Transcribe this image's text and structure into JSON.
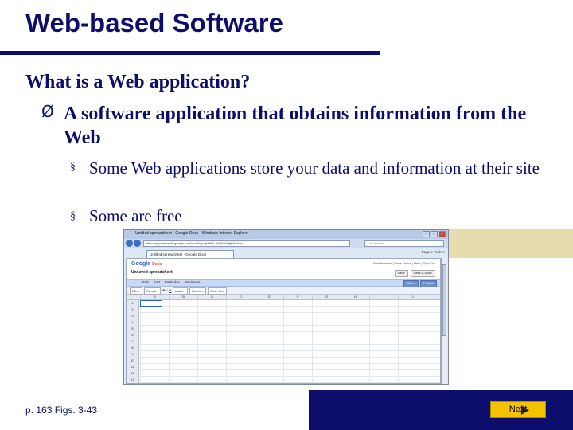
{
  "slide": {
    "title": "Web-based Software",
    "heading": "What is a Web application?",
    "bullet_level1": {
      "marker": "Ø",
      "text": "A software application that obtains information from the Web"
    },
    "bullets_level2": [
      {
        "marker": "§",
        "text": "Some Web applications store your data and information at their site"
      },
      {
        "marker": "§",
        "text": "Some are free"
      }
    ],
    "caption": "p. 163 Figs. 3-43",
    "next_label": "Next"
  },
  "browser": {
    "window_title": "Untitled spreadsheet - Google Docs - Windows Internet Explorer",
    "window_controls": [
      "–",
      "□",
      "×"
    ],
    "address": "http://spreadsheets.google.com/ccc?key=pYMeL-hQFmN8gWsIAdw",
    "search_placeholder": "Live Search",
    "tab_label": "Untitled spreadsheet - Google Docs",
    "tab_tools": "Page ▾  Tools ▾",
    "page": {
      "logo": "Google",
      "logo_sub": "Docs",
      "doc_name": "Unsaved spreadsheet",
      "top_links": "| New features | Docs Home | Help | Sign Out",
      "top_buttons": [
        "Save",
        "Save & close"
      ],
      "menu": [
        "Edit",
        "Sort",
        "Formulas",
        "Revisions"
      ],
      "share_buttons": [
        "Share",
        "Publish"
      ],
      "toolbar": [
        "File ▾",
        "Format ▾",
        "B",
        "I",
        "U",
        "Insert ▾",
        "Delete ▾",
        "Wrap Text"
      ],
      "columns": [
        "A",
        "B",
        "C",
        "D",
        "E",
        "F",
        "G",
        "H",
        "I",
        "J",
        "K"
      ],
      "rows": [
        "1",
        "2",
        "3",
        "4",
        "5",
        "6",
        "7",
        "8",
        "9",
        "10",
        "11",
        "12",
        "13"
      ]
    }
  },
  "colors": {
    "navy": "#0d0d6b",
    "tan": "#e6dcae",
    "next_button": "#f5c200"
  }
}
